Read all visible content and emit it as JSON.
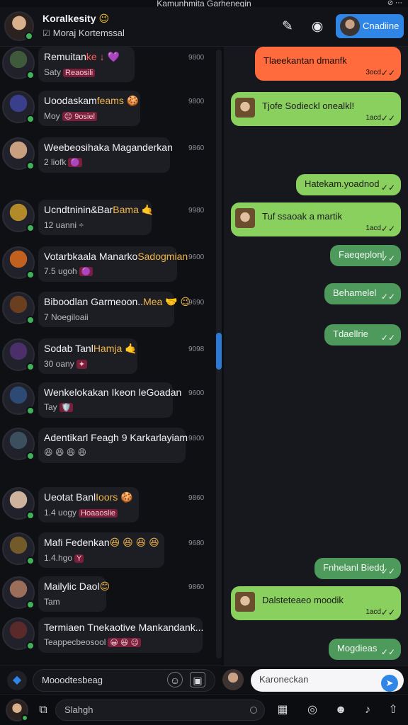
{
  "top_caption": "Kamunhmita Garhenegin",
  "header": {
    "name": "Koralkesity",
    "name_emoji": "😉",
    "subtitle": "Moraj Kortemssal",
    "cta_label": "Cnadiine"
  },
  "conversations": [
    {
      "title": "Remuitan",
      "title_extra": "ke ↓ 💜",
      "sub": "Saty",
      "sub_extra": "Reaosili",
      "time": "9800",
      "av": "#3f5a3a"
    },
    {
      "title": "Uoodaskam",
      "title_extra": "feams 🍪",
      "sub": "Moy",
      "sub_extra": "😊 9osiel",
      "time": "9800",
      "av": "#3a3f8c"
    },
    {
      "title": "Weebeosihaka Maganderkan",
      "title_extra": "",
      "sub": "2 liofk",
      "sub_extra": "🟣",
      "time": "9860",
      "av": "#c8a07f"
    },
    {
      "title": "Ucndtninin&Bar",
      "title_extra": "Bama 🤙",
      "sub": "12 uanni ÷",
      "sub_extra": "",
      "time": "9980",
      "av": "#b38a2a"
    },
    {
      "title": "Votarbkaala Manarko",
      "title_extra": "Sadogmian",
      "sub": "7.5 ugoh",
      "sub_extra": "🟣",
      "time": "9600",
      "av": "#c2601f"
    },
    {
      "title": "Biboodlan Garmeoon..",
      "title_extra": "Mea 🤝 😉",
      "sub": "7 Noegiloaii",
      "sub_extra": "",
      "time": "9690",
      "av": "#6a3f20"
    },
    {
      "title": "Sodab Tanl",
      "title_extra": "Hamja 🤙",
      "sub": "30 oany",
      "sub_extra": "✦",
      "time": "9098",
      "av": "#4b2f6a"
    },
    {
      "title": "Wenkelokakan Ikeon leGoadan",
      "title_extra": "",
      "sub": "Tay",
      "sub_extra": "🛡️",
      "time": "9600",
      "av": "#2d4a75"
    },
    {
      "title": "Adentikarl Feagh 9 Karkarlayiam",
      "title_extra": "",
      "sub": "😆 😆 😆 😆",
      "sub_extra": "",
      "time": "9800",
      "av": "#3c4f5e"
    },
    {
      "title": "Ueotat Banl",
      "title_extra": "Ioors 🍪",
      "sub": "1.4 uogy",
      "sub_extra": "Hoaaoslie",
      "time": "9860",
      "av": "#cdb39d"
    },
    {
      "title": "Mafi Fedenkan",
      "title_extra": "😆 😆 😆 😆",
      "sub": "1.4.hgo",
      "sub_extra": "Y",
      "time": "9680",
      "av": "#725a2b"
    },
    {
      "title": "Mailylic Daol",
      "title_extra": "😊",
      "sub": "Tam",
      "sub_extra": "",
      "time": "9860",
      "av": "#9b6e5a"
    },
    {
      "title": "Termiaen Tnekaotive Mankandank...",
      "title_extra": "",
      "sub": "Teappecbeosool",
      "sub_extra": "😀 😆 😉",
      "time": "",
      "av": "#5a2a2a"
    }
  ],
  "messages": [
    {
      "text": "Tlaeekantan dmanfk",
      "time": "3ocd",
      "color": "orange"
    },
    {
      "text": "Tjofe Sodieckl onealkl!",
      "time": "1acd",
      "color": "green",
      "thumb": true
    },
    {
      "text": "Hatekam.yoadnod",
      "time": "",
      "color": "green"
    },
    {
      "text": "Tuf ssaoak a martik",
      "time": "1acd",
      "color": "green",
      "thumb": true
    },
    {
      "text": "Faeqeplonl",
      "time": "",
      "color": "dark-green"
    },
    {
      "text": "Behamelel",
      "time": "",
      "color": "dark-green"
    },
    {
      "text": "Tdaellrie",
      "time": "",
      "color": "dark-green"
    },
    {
      "text": "Fnhelanl Biedd",
      "time": "",
      "color": "dark-green"
    },
    {
      "text": "Dalsteteaeo moodik",
      "time": "1acd",
      "color": "green",
      "thumb": true
    },
    {
      "text": "Mogdieas",
      "time": "",
      "color": "dark-green"
    }
  ],
  "composer": {
    "left_placeholder": "Mooodtesbeag",
    "right_placeholder": "Karoneckan"
  },
  "bottom": {
    "search_placeholder": "Slahgh"
  }
}
